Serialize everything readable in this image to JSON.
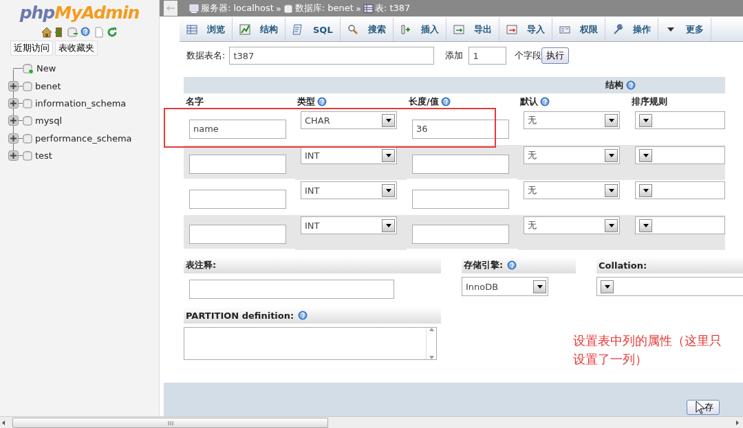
{
  "sidebar": {
    "logo": {
      "part_1": "php",
      "part_2": "MyAdmin"
    },
    "tabs": [
      "近期访问",
      "表收藏夹"
    ],
    "tree": [
      {
        "label": "New",
        "kind": "new"
      },
      {
        "label": "benet",
        "kind": "database",
        "expanded": false
      },
      {
        "label": "information_schema",
        "kind": "database",
        "expanded": false
      },
      {
        "label": "mysql",
        "kind": "database",
        "expanded": false
      },
      {
        "label": "performance_schema",
        "kind": "database",
        "expanded": false
      },
      {
        "label": "test",
        "kind": "database",
        "expanded": false
      }
    ]
  },
  "breadcrumb": {
    "separator": "»",
    "items": [
      {
        "label": "服务器: localhost",
        "kind": "server"
      },
      {
        "label": "数据库: benet",
        "kind": "database"
      },
      {
        "label": "表: t387",
        "kind": "table"
      }
    ]
  },
  "tabs": [
    {
      "label": "浏览",
      "kind": "browse",
      "selected": false
    },
    {
      "label": "结构",
      "kind": "structure",
      "selected": false
    },
    {
      "label": "SQL",
      "kind": "sql",
      "selected": false
    },
    {
      "label": "搜索",
      "kind": "search",
      "selected": false
    },
    {
      "label": "插入",
      "kind": "insert",
      "selected": false
    },
    {
      "label": "导出",
      "kind": "export",
      "selected": false
    },
    {
      "label": "导入",
      "kind": "import",
      "selected": false
    },
    {
      "label": "权限",
      "kind": "privileges",
      "selected": false
    },
    {
      "label": "操作",
      "kind": "operations",
      "selected": false
    },
    {
      "label": "更多",
      "kind": "more",
      "selected": false
    }
  ],
  "form": {
    "table_name_label": "数据表名:",
    "table_name": "t387",
    "add_label": "添加",
    "add_count": "1",
    "fields_label": "个字段",
    "go_button": "执行"
  },
  "structure": {
    "heading": "结构",
    "columns": [
      {
        "label": "名字",
        "help": false
      },
      {
        "label": "类型",
        "help": true
      },
      {
        "label": "长度/值",
        "help": true
      },
      {
        "label": "默认",
        "help": true
      },
      {
        "label": "排序规则",
        "help": false
      }
    ],
    "rows": [
      {
        "name": "name",
        "type": "CHAR",
        "length": "36",
        "default": "无"
      },
      {
        "type": "INT",
        "default": "无"
      },
      {
        "type": "INT",
        "default": "无"
      },
      {
        "type": "INT",
        "default": "无"
      }
    ]
  },
  "options": {
    "comment_label": "表注释:",
    "engine_label": "存储引擎:",
    "engine": "InnoDB",
    "collation_label": "Collation:",
    "partition_label": "PARTITION definition:"
  },
  "save_button": "存",
  "annotation": "设置表中列的属性（这里只设置了一列）"
}
